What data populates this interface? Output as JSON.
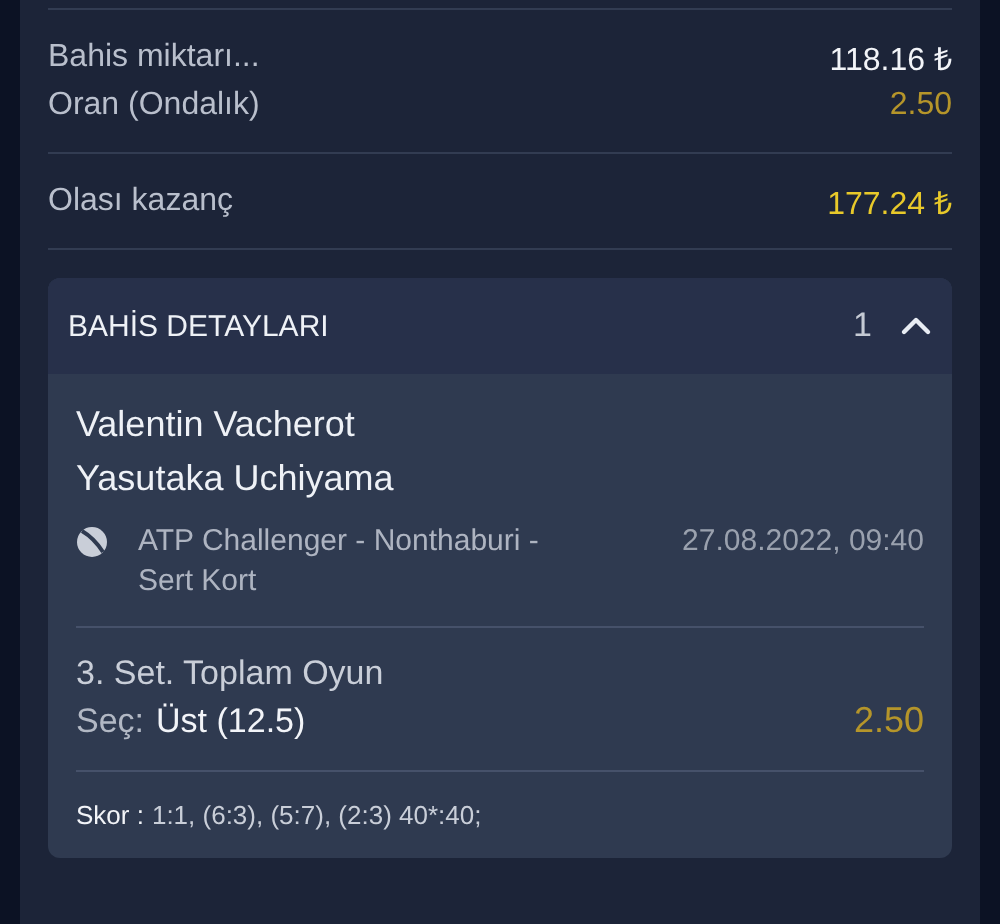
{
  "summary": [
    [
      {
        "kind": "amount",
        "label": "Bahis miktarı...",
        "value": "118.16 ₺"
      },
      {
        "kind": "odds",
        "label": "Oran (Ondalık)",
        "value": "2.50"
      }
    ],
    [
      {
        "kind": "win",
        "label": "Olası kazanç",
        "value": "177.24 ₺"
      }
    ]
  ],
  "details": {
    "title": "BAHİS DETAYLARI",
    "count": "1",
    "expanded": true,
    "teams": [
      "Valentin Vacherot",
      "Yasutaka Uchiyama"
    ],
    "league": "ATP Challenger - Nonthaburi - Sert Kort",
    "datetime": "27.08.2022, 09:40",
    "market": "3. Set. Toplam Oyun",
    "selection_label": "Seç:",
    "selection": "Üst (12.5)",
    "odds": "2.50",
    "score_label": "Skor :",
    "score": "1:1, (6:3), (5:7), (2:3) 40*:40;"
  }
}
